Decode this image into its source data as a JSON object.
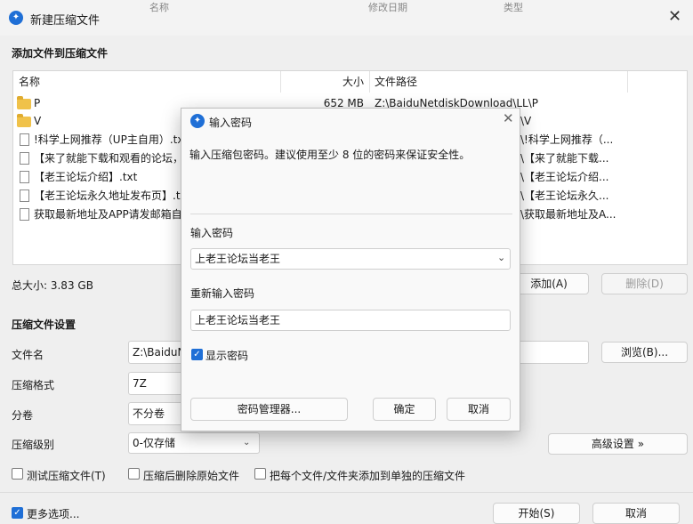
{
  "window": {
    "title": "新建压缩文件",
    "bg_tabs": [
      "名称",
      "修改日期",
      "类型"
    ]
  },
  "files_section": {
    "title": "添加文件到压缩文件",
    "columns": {
      "name": "名称",
      "size": "大小",
      "path": "文件路径"
    },
    "rows": [
      {
        "icon": "folder-icon",
        "name": "P",
        "size": "652 MB",
        "path": "Z:\\BaiduNetdiskDownload\\LL\\P"
      },
      {
        "icon": "folder-icon",
        "name": "V",
        "size": "",
        "path": "\\V"
      },
      {
        "icon": "document-icon",
        "name": "!科学上网推荐（UP主自用）.txt",
        "size": "",
        "path": "\\!科学上网推荐（..."
      },
      {
        "icon": "document-icon",
        "name": "【来了就能下载和观看的论坛，",
        "size": "",
        "path": "\\【来了就能下载..."
      },
      {
        "icon": "document-icon",
        "name": "【老王论坛介绍】.txt",
        "size": "",
        "path": "\\【老王论坛介绍..."
      },
      {
        "icon": "document-icon",
        "name": "【老王论坛永久地址发布页】.txt",
        "size": "",
        "path": "\\【老王论坛永久..."
      },
      {
        "icon": "document-icon",
        "name": "获取最新地址及APP请发邮箱自",
        "size": "",
        "path": "\\获取最新地址及A..."
      }
    ],
    "total_size": "总大小: 3.83 GB",
    "add_button": "添加(A)",
    "delete_button": "删除(D)"
  },
  "settings": {
    "title": "压缩文件设置",
    "filename_label": "文件名",
    "filename_value": "Z:\\BaiduN",
    "browse_button": "浏览(B)...",
    "format_label": "压缩格式",
    "format_value": "7Z",
    "split_label": "分卷",
    "split_value": "不分卷",
    "level_label": "压缩级别",
    "level_value": "0-仅存储",
    "advanced_button": "高级设置 »",
    "test_checkbox": "测试压缩文件(T)",
    "delete_after_checkbox": "压缩后删除原始文件",
    "each_file_checkbox": "把每个文件/文件夹添加到单独的压缩文件"
  },
  "footer": {
    "more_options": "更多选项...",
    "start_button": "开始(S)",
    "cancel_button": "取消"
  },
  "password_dialog": {
    "title": "输入密码",
    "description": "输入压缩包密码。建议使用至少 8 位的密码来保证安全性。",
    "password_label": "输入密码",
    "password_value": "上老王论坛当老王",
    "confirm_label": "重新输入密码",
    "confirm_value": "上老王论坛当老王",
    "show_password": "显示密码",
    "manager_button": "密码管理器...",
    "ok_button": "确定",
    "cancel_button": "取消"
  },
  "colors": {
    "accent": "#1f6fd6",
    "folder": "#f0c24a"
  }
}
